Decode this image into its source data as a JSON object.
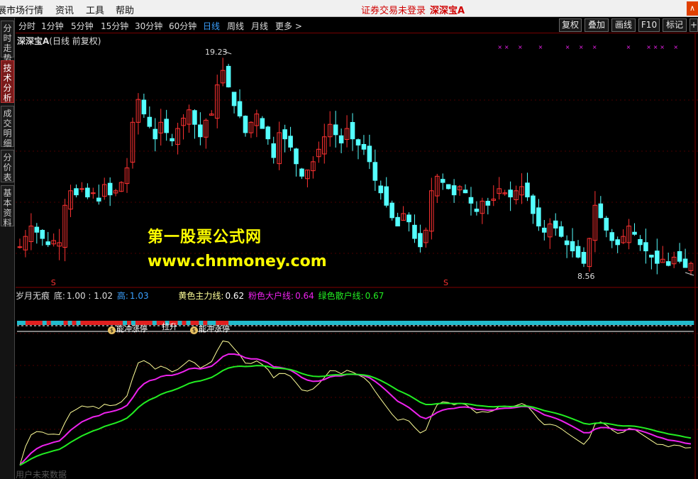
{
  "menu": {
    "items": [
      "展市场行情",
      "资讯",
      "工具",
      "帮助"
    ],
    "login_status": "证券交易未登录",
    "security_name": "深深宝A",
    "corner_label": "∧"
  },
  "left_tabs": [
    "分时走势",
    "技术分析",
    "成交明细",
    "分价表",
    "基本资料"
  ],
  "period_bar": {
    "items": [
      "分时",
      "1分钟",
      "5分钟",
      "15分钟",
      "30分钟",
      "60分钟",
      "日线",
      "周线",
      "月线",
      "更多 >"
    ],
    "active": "日线",
    "tools": [
      "复权",
      "叠加",
      "画线",
      "F10",
      "标记",
      "+自"
    ]
  },
  "main_chart": {
    "title_name": "深深宝A",
    "title_suffix": "(日线 前复权)",
    "high_label": "19.23",
    "low_label": "8.56",
    "s_marker": "S"
  },
  "watermark": {
    "text_cn": "第一股票公式网",
    "text_url": "www.chnmoney.com"
  },
  "indicator": {
    "name": "岁月无痕",
    "bottom_label": "底:",
    "bottom_values": "1.00 : 1.02",
    "high_label": "高:",
    "high_value": "1.03",
    "yellow_label": "黄色主力线:",
    "yellow_value": "0.62",
    "pink_label": "粉色大户线:",
    "pink_value": "0.64",
    "green_label": "绿色散户线:",
    "green_value": "0.67",
    "ann1": "能冲涨停",
    "ann2": "拉升",
    "ann3": "能冲涨停",
    "footer": "用户未来数据",
    "colors": {
      "yellow": "#ffff99",
      "pink": "#ee22ee",
      "green": "#22ee22",
      "cyan": "#22bbcc",
      "red": "#e02020"
    }
  },
  "chart_data": {
    "type": "candlestick",
    "high": 19.23,
    "low": 8.56,
    "closes": [
      9.8,
      10.3,
      10.8,
      10.5,
      10.2,
      9.9,
      10.1,
      10.0,
      11.8,
      12.5,
      12.3,
      12.6,
      12.2,
      12.4,
      12.0,
      12.8,
      12.3,
      12.5,
      12.9,
      13.6,
      15.8,
      16.9,
      16.2,
      15.6,
      15.0,
      15.8,
      15.3,
      14.9,
      15.5,
      16.0,
      16.4,
      15.7,
      15.1,
      15.9,
      16.2,
      17.6,
      18.3,
      17.5,
      16.6,
      16.1,
      15.3,
      15.8,
      16.2,
      15.5,
      15.0,
      14.1,
      15.3,
      15.0,
      14.6,
      13.8,
      13.2,
      13.5,
      13.9,
      14.5,
      15.1,
      15.7,
      15.2,
      14.8,
      15.5,
      15.0,
      14.7,
      14.5,
      13.9,
      13.0,
      12.4,
      11.8,
      11.2,
      10.8,
      11.4,
      11.0,
      10.2,
      9.8,
      10.6,
      12.5,
      13.2,
      12.9,
      12.6,
      12.3,
      12.7,
      12.4,
      11.9,
      11.5,
      12.0,
      11.8,
      12.1,
      12.6,
      12.4,
      12.2,
      12.5,
      12.7,
      12.2,
      11.4,
      10.8,
      10.5,
      10.9,
      10.7,
      10.3,
      9.9,
      9.6,
      9.3,
      9.0,
      10.2,
      11.8,
      11.2,
      10.6,
      10.1,
      9.9,
      10.3,
      10.8,
      10.4,
      9.9,
      9.6,
      9.3,
      9.0,
      9.2,
      8.9,
      9.3,
      9.1,
      8.8,
      9.0
    ]
  }
}
